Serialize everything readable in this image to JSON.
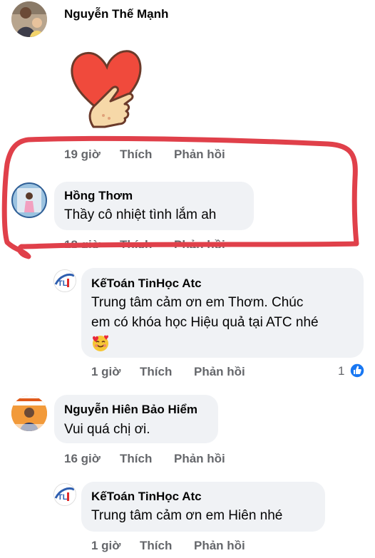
{
  "comments": [
    {
      "author": "Nguyễn Thế Mạnh",
      "sticker": "heart-hand-sticker",
      "time": "19 giờ",
      "like_label": "Thích",
      "reply_label": "Phản hồi"
    },
    {
      "author": "Hồng Thơm",
      "text": "Thầy cô nhiệt tình lắm ah",
      "time": "18 giờ",
      "like_label": "Thích",
      "reply_label": "Phản hồi"
    },
    {
      "author": "KếToán TinHọc Atc",
      "text_lines": [
        "Trung tâm cảm ơn em Thơm. Chúc",
        "em có khóa học Hiệu quả tại ATC nhé"
      ],
      "emoji": "smiling-face-with-hearts",
      "time": "1 giờ",
      "like_label": "Thích",
      "reply_label": "Phản hồi",
      "reaction_count": "1",
      "reaction_icon": "like-icon"
    },
    {
      "author": "Nguyễn Hiên Bảo Hiểm",
      "text": "Vui quá chị ơi.",
      "time": "16 giờ",
      "like_label": "Thích",
      "reply_label": "Phản hồi"
    },
    {
      "author": "KếToán TinHọc Atc",
      "text": "Trung tâm cảm ơn em Hiên nhé",
      "time": "1 giờ",
      "like_label": "Thích",
      "reply_label": "Phản hồi"
    }
  ],
  "colors": {
    "bubble": "#f0f2f5",
    "meta_text": "#65676b",
    "highlight_ink": "#e0404a",
    "like_blue": "#1877f2"
  }
}
